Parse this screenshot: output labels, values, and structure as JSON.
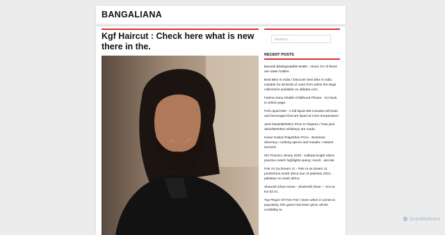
{
  "site": {
    "title": "BANGALIANA"
  },
  "post": {
    "title": "Kgf Haircut : Check here what is new there in the."
  },
  "search": {
    "placeholder": "SEARCH..."
  },
  "sidebar": {
    "recent_title": "RECENT POSTS",
    "recent_posts": [
      "Bacardi Biodegradable Bottle : About 1% of these are water bottles.",
      "Best Bike In India / Discover best bike in india suitable for all kinds of uses from within the large collections available on alibaba.com.",
      "Fatima Sana Shaikh Childhood Photos - Go back to article page.",
      "Full Liquid Diet - A full liquid diet includes all foods and beverages that are liquid at room temperature.",
      "Jack Daniel&#039;s Price In Rupees / How jack daniel&#039;s whiskeys are made.",
      "Kesar Kasturi Rajasthan Price - Business directory» cooking spices and masala » kasturi turmeric.",
      "Kkr Practice Jersey 2020 : Kolkata knight riders practice match highlights &amp; result · ami kkr.",
      "Pak Vs Sa Dream 11 - Pak vs sa dream 11 predictions south africa tour of pakistan 2021, pakistan vs south africa:",
      "Shaurah Khan Home - Shahrukh khan — koi na koi 02:41.",
      "Top Player Of Free Fire / Even when it comes to popularity, this game has been given all the credibility to."
    ]
  },
  "watermark": {
    "label": "ScanMalware"
  }
}
